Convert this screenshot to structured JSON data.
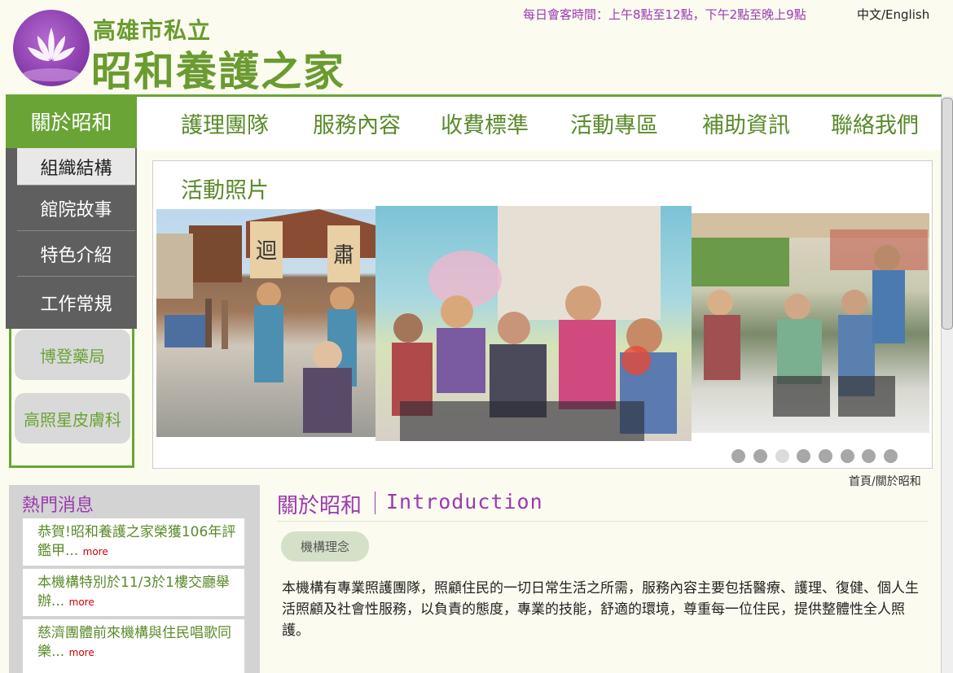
{
  "header": {
    "brand_sub": "高雄市私立",
    "brand_main": "昭和養護之家",
    "visit_hours": "每日會客時間：上午8點至12點，下午2點至晚上9點",
    "lang_switch": "中文/English"
  },
  "nav": {
    "active": "關於昭和",
    "items": [
      "護理團隊",
      "服務內容",
      "收費標準",
      "活動專區",
      "補助資訊",
      "聯絡我們"
    ]
  },
  "dropdown": {
    "items": [
      "組織結構",
      "館院故事",
      "特色介紹",
      "工作常規"
    ]
  },
  "links": [
    "博登藥局",
    "高照星皮膚科"
  ],
  "activity": {
    "title": "活動照片",
    "slide_dots": 8,
    "active_dot": 3
  },
  "breadcrumb": "首頁/關於昭和",
  "news": {
    "title": "熱門消息",
    "items": [
      {
        "text": "恭賀!昭和養護之家榮獲106年評鑑甲",
        "ellipsis": "...",
        "more": "more"
      },
      {
        "text": "本機構特別於11/3於1樓交廳舉辦",
        "ellipsis": "...",
        "more": "more"
      },
      {
        "text": "慈濟團體前來機構與住民唱歌同樂",
        "ellipsis": "...",
        "more": "more"
      }
    ]
  },
  "intro": {
    "title": "關於昭和",
    "title_en": "Introduction",
    "concept_label": "機構理念",
    "body": "本機構有專業照護團隊，照顧住民的一切日常生活之所需，服務內容主要包括醫療、護理、復健、個人生活照顧及社會性服務，以負責的態度，專業的技能，舒適的環境，尊重每一位住民，提供整體性全人照護。"
  },
  "colors": {
    "brand_green": "#6aa436",
    "brand_purple": "#9a3ab0",
    "dropdown_gray": "#5f5f5f"
  }
}
